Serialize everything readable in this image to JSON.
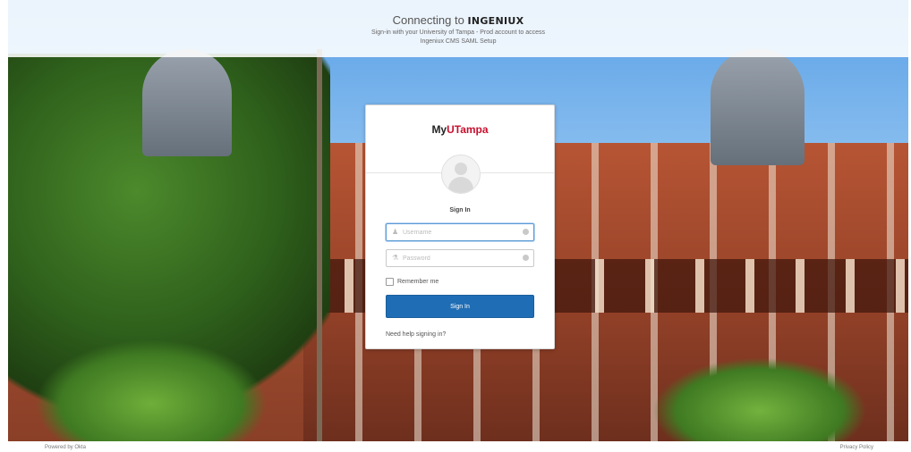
{
  "header": {
    "title_prefix": "Connecting to",
    "brand": "INGENIUX",
    "subtitle_line1": "Sign-in with your University of Tampa - Prod account to access",
    "subtitle_line2": "Ingeniux CMS SAML Setup"
  },
  "card": {
    "logo_prefix": "My",
    "logo_accent": "UTampa",
    "heading": "Sign In",
    "username": {
      "value": "",
      "placeholder": "Username"
    },
    "password": {
      "value": "",
      "placeholder": "Password"
    },
    "remember_label": "Remember me",
    "submit_label": "Sign In",
    "help_link": "Need help signing in?"
  },
  "footer": {
    "powered_by": "Powered by Okta",
    "privacy": "Privacy Policy"
  },
  "colors": {
    "primary_button": "#1f6db5",
    "logo_accent": "#c8102e"
  },
  "icons": [
    "user-icon",
    "lock-icon",
    "help-icon",
    "avatar-placeholder"
  ]
}
